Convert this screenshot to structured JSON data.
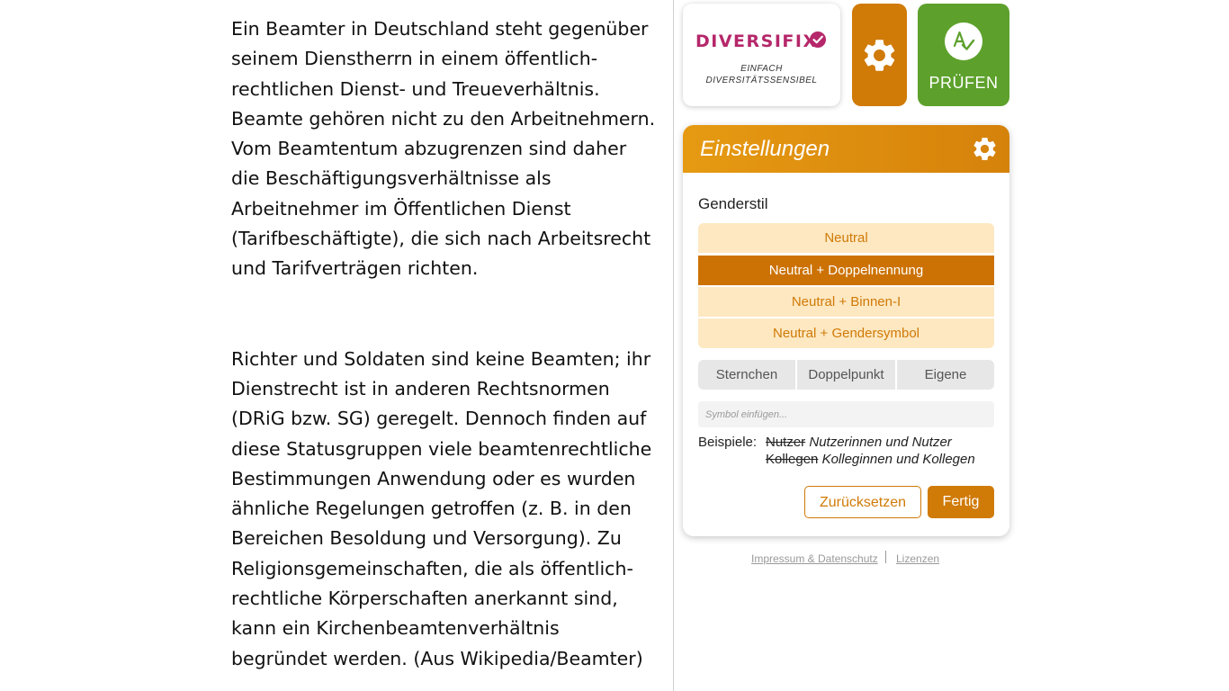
{
  "document": {
    "paragraphs": [
      "Ein Beamter in Deutschland steht gegenüber seinem Dienstherrn in einem öffentlich-rechtlichen Dienst- und Treueverhältnis. Beamte gehören nicht zu den Arbeitnehmern. Vom Beamtentum abzugrenzen sind daher die Beschäftigungsverhältnisse als Arbeitnehmer im Öffentlichen Dienst (Tarifbeschäftigte), die sich nach Arbeitsrecht und Tarifverträgen richten.",
      "Richter und Soldaten sind keine Beamten; ihr Dienstrecht ist in anderen Rechtsnormen (DRiG bzw. SG) geregelt. Dennoch finden auf diese Statusgruppen viele beamtenrechtliche Bestimmungen Anwendung oder es wurden ähnliche Regelungen getroffen (z. B. in den Bereichen Besoldung und Versorgung). Zu Religionsgemeinschaften, die als öffentlich-rechtliche Körperschaften anerkannt sind, kann ein Kirchenbeamtenverhältnis begründet werden. (Aus Wikipedia/Beamter)"
    ]
  },
  "logo": {
    "name": "DIVERSIFIX",
    "tagline_1": "EINFACH",
    "tagline_2": "DIVERSITÄTSSENSIBEL"
  },
  "toolbar": {
    "check_label": "PRÜFEN",
    "settings_icon": "gear-icon",
    "check_icon": "spellcheck-icon"
  },
  "settings": {
    "title": "Einstellungen",
    "gender_style_label": "Genderstil",
    "options": [
      {
        "label": "Neutral",
        "selected": false
      },
      {
        "label": "Neutral + Doppelnennung",
        "selected": true
      },
      {
        "label": "Neutral + Binnen-I",
        "selected": false
      },
      {
        "label": "Neutral + Gendersymbol",
        "selected": false
      }
    ],
    "symbols": [
      "Sternchen",
      "Doppelpunkt",
      "Eigene"
    ],
    "symbol_placeholder": "Symbol einfügen...",
    "examples_label": "Beispiele:",
    "examples": [
      {
        "original": "Nutzer",
        "replacement": "Nutzerinnen und Nutzer"
      },
      {
        "original": "Kollegen",
        "replacement": "Kolleginnen und Kollegen"
      }
    ],
    "reset_label": "Zurücksetzen",
    "done_label": "Fertig"
  },
  "footer": {
    "imprint": "Impressum & Datenschutz",
    "licenses": "Lizenzen"
  },
  "colors": {
    "brand_magenta": "#b5276a",
    "orange": "#d07a07",
    "green": "#5da12c",
    "option_bg": "#fde8c2"
  }
}
